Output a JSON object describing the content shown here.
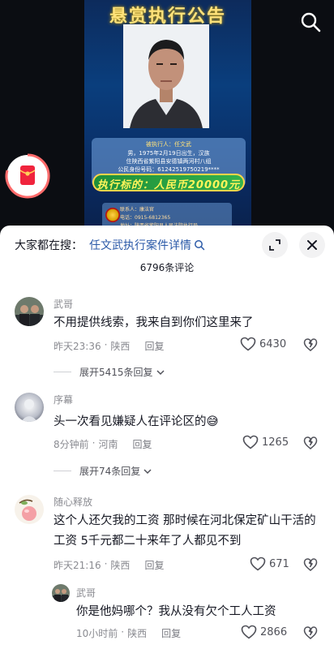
{
  "video": {
    "poster_title": "悬赏执行公告",
    "info_lines": [
      "被执行人：任文武",
      "男，1975年2月19日出生，汉族",
      "住陕西省紫阳县安德镇两河村八组",
      "公民身份号码：61242519750219****"
    ],
    "reward": "执行标的：人民币20000元",
    "contact_lines": [
      "联系人：康法官",
      "电话：0915-6812365",
      "地址：陕西省紫阳县人民法院执行局"
    ],
    "colors": {
      "poster_bg": "#0a3e7d",
      "title": "#ffe27a",
      "banner": "#32b24c",
      "reward_text": "#fff45a"
    }
  },
  "icons": {
    "top_search": "search-icon",
    "red_packet": "red-packet-icon",
    "resize": "expand-icon",
    "close": "close-icon"
  },
  "sheet": {
    "search_prefix": "大家都在搜：",
    "search_link": "任文武执行案件详情",
    "comment_count": "6796条评论",
    "link_color": "#2b5aa8"
  },
  "comments": [
    {
      "user": "武哥",
      "text": "不用提供线索，我来自到你们这里来了",
      "time": "昨天23:36",
      "location": "陕西",
      "reply": "回复",
      "likes": "6430",
      "expand": "展开5415条回复"
    },
    {
      "user": "序幕",
      "text": "头一次看见嫌疑人在评论区的😅",
      "time": "8分钟前",
      "location": "河南",
      "reply": "回复",
      "likes": "1265",
      "expand": "展开74条回复"
    },
    {
      "user": "随心释放",
      "text": "这个人还欠我的工资 那时候在河北保定矿山干活的工资 5千元都二十来年了人都见不到",
      "time": "昨天21:16",
      "location": "陕西",
      "reply": "回复",
      "likes": "671"
    },
    {
      "user": "武哥",
      "text": "你是他妈哪个？我从没有欠个工人工资",
      "time": "10小时前",
      "location": "陕西",
      "reply": "回复",
      "likes": "2866"
    }
  ]
}
